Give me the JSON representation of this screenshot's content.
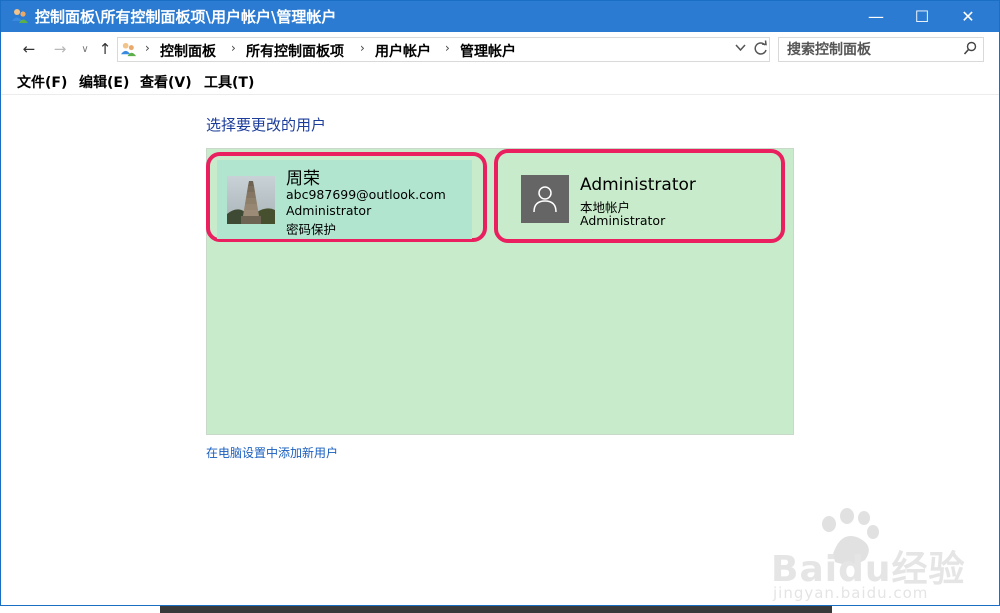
{
  "window": {
    "title": "控制面板\\所有控制面板项\\用户帐户\\管理帐户",
    "icon": "users-icon",
    "minimize": "—",
    "maximize": "☐",
    "close": "✕"
  },
  "nav": {
    "back": "←",
    "forward": "→",
    "recent": "∨",
    "up": "↑"
  },
  "breadcrumb": [
    "控制面板",
    "所有控制面板项",
    "用户帐户",
    "管理帐户"
  ],
  "breadcrumb_separator": "›",
  "search": {
    "placeholder": "搜索控制面板"
  },
  "menu": [
    "文件(F)",
    "编辑(E)",
    "查看(V)",
    "工具(T)"
  ],
  "main": {
    "heading": "选择要更改的用户",
    "accounts": [
      {
        "name": "周荣",
        "lines": [
          "abc987699@outlook.com",
          "Administrator",
          "密码保护"
        ],
        "avatar": "pagoda-photo"
      },
      {
        "name": "Administrator",
        "lines": [
          "本地帐户",
          "Administrator"
        ],
        "avatar": "default-user-icon"
      }
    ],
    "add_user_link": "在电脑设置中添加新用户"
  },
  "watermark": {
    "brand": "Baidu经验",
    "url": "jingyan.baidu.com"
  },
  "colors": {
    "titlebar": "#2b7bd2",
    "heading": "#1c3d9a",
    "panel": "#c8eccb",
    "selected_card": "#b2e5d0",
    "highlight_border": "#ea1f5f",
    "link": "#1a5fbf"
  }
}
